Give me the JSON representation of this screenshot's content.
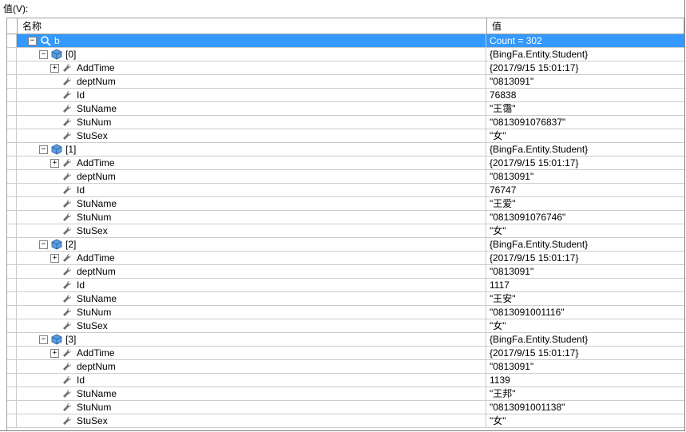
{
  "panel_label": "值(V):",
  "columns": {
    "name": "名称",
    "value": "值"
  },
  "root": {
    "name": "b",
    "value": "Count = 302",
    "selected": true,
    "icon": "magnifier",
    "expander": "minus",
    "level": 0
  },
  "items": [
    {
      "index": "[0]",
      "value": "{BingFa.Entity.Student}",
      "expander": "minus",
      "props": [
        {
          "name": "AddTime",
          "value": "{2017/9/15 15:01:17}",
          "expander": "plus"
        },
        {
          "name": "deptNum",
          "value": "\"0813091\"",
          "expander": ""
        },
        {
          "name": "Id",
          "value": "76838",
          "expander": ""
        },
        {
          "name": "StuName",
          "value": "\"王霭\"",
          "expander": ""
        },
        {
          "name": "StuNum",
          "value": "\"0813091076837\"",
          "expander": ""
        },
        {
          "name": "StuSex",
          "value": "\"女\"",
          "expander": ""
        }
      ]
    },
    {
      "index": "[1]",
      "value": "{BingFa.Entity.Student}",
      "expander": "minus",
      "props": [
        {
          "name": "AddTime",
          "value": "{2017/9/15 15:01:17}",
          "expander": "plus"
        },
        {
          "name": "deptNum",
          "value": "\"0813091\"",
          "expander": ""
        },
        {
          "name": "Id",
          "value": "76747",
          "expander": ""
        },
        {
          "name": "StuName",
          "value": "\"王爱\"",
          "expander": ""
        },
        {
          "name": "StuNum",
          "value": "\"0813091076746\"",
          "expander": ""
        },
        {
          "name": "StuSex",
          "value": "\"女\"",
          "expander": ""
        }
      ]
    },
    {
      "index": "[2]",
      "value": "{BingFa.Entity.Student}",
      "expander": "minus",
      "props": [
        {
          "name": "AddTime",
          "value": "{2017/9/15 15:01:17}",
          "expander": "plus"
        },
        {
          "name": "deptNum",
          "value": "\"0813091\"",
          "expander": ""
        },
        {
          "name": "Id",
          "value": "1117",
          "expander": ""
        },
        {
          "name": "StuName",
          "value": "\"王安\"",
          "expander": ""
        },
        {
          "name": "StuNum",
          "value": "\"0813091001116\"",
          "expander": ""
        },
        {
          "name": "StuSex",
          "value": "\"女\"",
          "expander": ""
        }
      ]
    },
    {
      "index": "[3]",
      "value": "{BingFa.Entity.Student}",
      "expander": "minus",
      "props": [
        {
          "name": "AddTime",
          "value": "{2017/9/15 15:01:17}",
          "expander": "plus"
        },
        {
          "name": "deptNum",
          "value": "\"0813091\"",
          "expander": ""
        },
        {
          "name": "Id",
          "value": "1139",
          "expander": ""
        },
        {
          "name": "StuName",
          "value": "\"王邦\"",
          "expander": ""
        },
        {
          "name": "StuNum",
          "value": "\"0813091001138\"",
          "expander": ""
        },
        {
          "name": "StuSex",
          "value": "\"女\"",
          "expander": ""
        }
      ]
    }
  ]
}
